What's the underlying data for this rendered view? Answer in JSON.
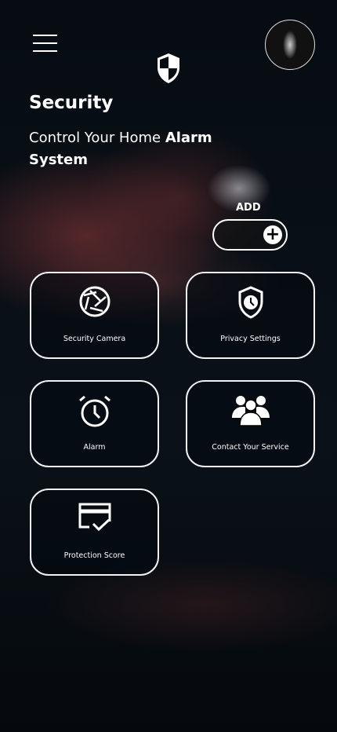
{
  "header": {
    "title": "Security",
    "subtitle_plain": "Control Your Home ",
    "subtitle_bold": "Alarm System",
    "add_label": "ADD"
  },
  "cards": [
    {
      "label": "Security Camera",
      "icon": "camera-aperture-icon"
    },
    {
      "label": "Privacy Settings",
      "icon": "shield-clock-icon"
    },
    {
      "label": "Alarm",
      "icon": "alarm-clock-icon"
    },
    {
      "label": "Contact Your Service",
      "icon": "users-icon"
    },
    {
      "label": "Protection Score",
      "icon": "card-check-icon"
    }
  ]
}
